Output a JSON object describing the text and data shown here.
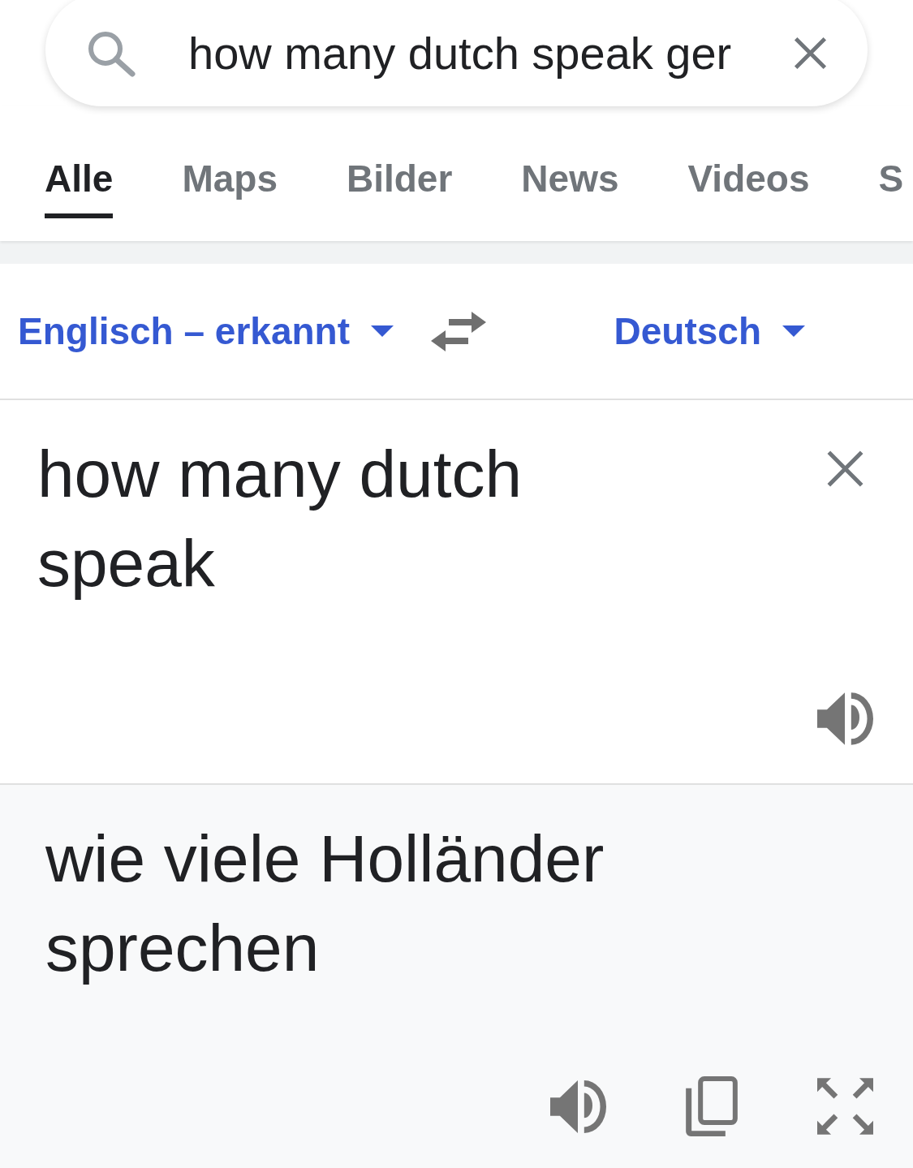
{
  "search": {
    "value": "how many dutch speak ger"
  },
  "tabs": [
    {
      "label": "Alle",
      "selected": true
    },
    {
      "label": "Maps",
      "selected": false
    },
    {
      "label": "Bilder",
      "selected": false
    },
    {
      "label": "News",
      "selected": false
    },
    {
      "label": "Videos",
      "selected": false
    },
    {
      "label": "S",
      "selected": false
    }
  ],
  "translator": {
    "source_language": "Englisch – erkannt",
    "target_language": "Deutsch",
    "source_text": "how many dutch speak",
    "translation": "wie viele Holländer sprechen"
  }
}
